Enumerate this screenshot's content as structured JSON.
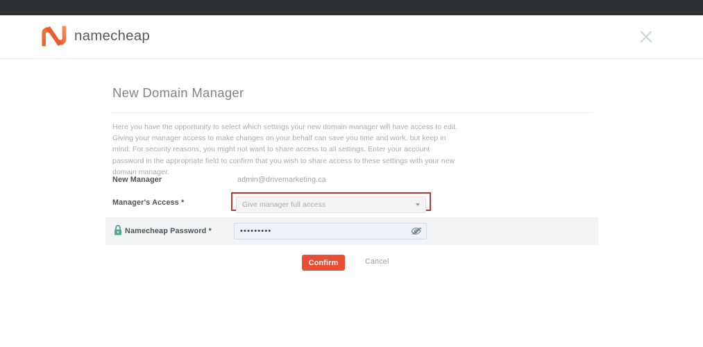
{
  "header": {
    "brand_name": "namecheap",
    "logo_icon": "namecheap-n-logo",
    "close_icon": "close-x-icon"
  },
  "page": {
    "title": "New Domain Manager",
    "intro": "Here you have the opportunity to select which settings your new domain manager will have access to edit. Giving your manager access to make changes on your behalf can save you time and work, but keep in mind: For security reasons, you might not want to share access to all settings. Enter your account password in the appropriate field to confirm that you wish to share access to these settings with your new domain manager."
  },
  "form": {
    "new_manager": {
      "label": "New Manager",
      "value": "admin@drivemarketing.ca"
    },
    "managers_access": {
      "label": "Manager's Access *",
      "selected": "Give manager full access",
      "caret_icon": "chevron-down-icon",
      "highlighted": true,
      "highlight_color": "#b23a34"
    },
    "password": {
      "label": "Namecheap Password *",
      "lock_icon": "lock-icon",
      "value": "•••••••••",
      "placeholder": "",
      "toggle_icon": "eye-slash-icon"
    }
  },
  "actions": {
    "confirm_label": "Confirm",
    "cancel_label": "Cancel",
    "confirm_color": "#e84e35"
  }
}
